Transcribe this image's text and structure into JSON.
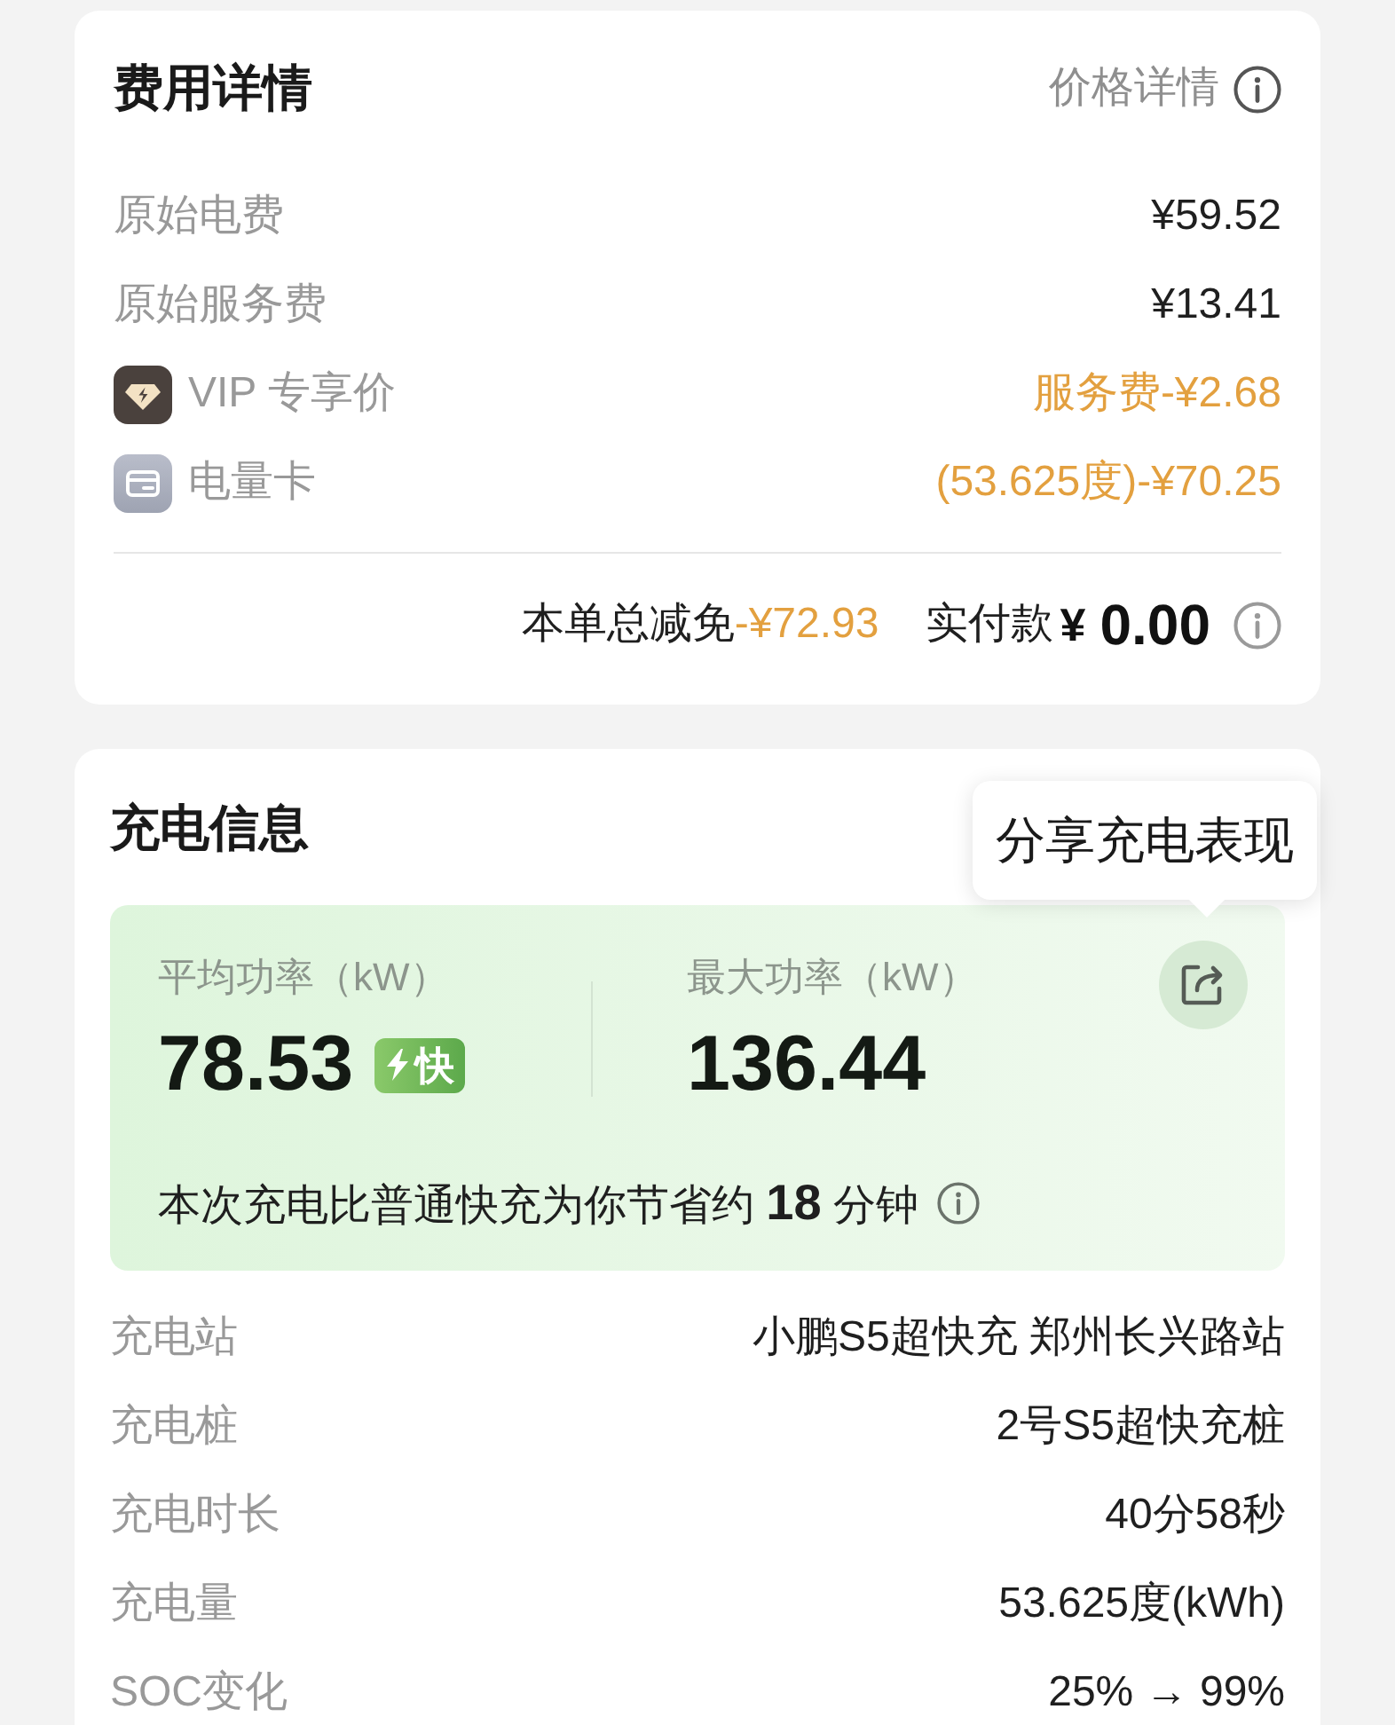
{
  "fee_card": {
    "title": "费用详情",
    "price_details_link": "价格详情",
    "rows": [
      {
        "kind": "plain",
        "label": "原始电费",
        "value": "¥59.52"
      },
      {
        "kind": "plain",
        "label": "原始服务费",
        "value": "¥13.41"
      },
      {
        "kind": "vip",
        "label": "VIP 专享价",
        "value": "服务费-¥2.68"
      },
      {
        "kind": "card",
        "label": "电量卡",
        "value": "(53.625度)-¥70.25"
      }
    ],
    "summary": {
      "discount_label": "本单总减免",
      "discount_amount": "-¥72.93",
      "paid_label": "实付款",
      "paid_currency": "¥",
      "paid_amount": "0.00"
    }
  },
  "charging_card": {
    "title": "充电信息",
    "share_tooltip": "分享充电表现",
    "power": {
      "average_label": "平均功率（kW）",
      "average_value": "78.53",
      "badge": "快",
      "max_label": "最大功率（kW）",
      "max_value": "136.44"
    },
    "saving_note": "本次充电比普通快充为你节省约 **18** 分钟",
    "rows": [
      {
        "label": "充电站",
        "value": "小鹏S5超快充 郑州长兴路站"
      },
      {
        "label": "充电桩",
        "value": "2号S5超快充桩"
      },
      {
        "label": "充电时长",
        "value": "40分58秒"
      },
      {
        "label": "充电量",
        "value": "53.625度(kWh)"
      },
      {
        "label": "SOC变化",
        "value": "25% → 99%"
      }
    ]
  }
}
